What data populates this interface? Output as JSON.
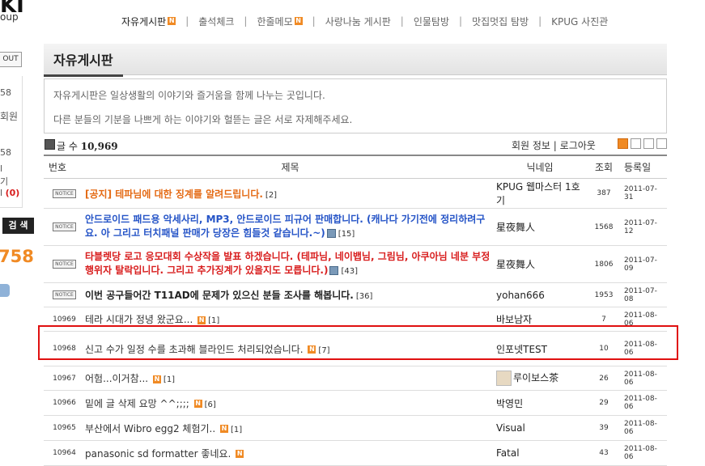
{
  "left": {
    "logo": "KI",
    "logo_sub": "oup",
    "out_label": "OUT",
    "side_lines": [
      "58",
      "회원",
      "58",
      "l",
      "기",
      "l"
    ],
    "side_count_red": "(0)",
    "search_label": "검 색",
    "big_count": "758"
  },
  "topnav": {
    "items": [
      {
        "label": "자유게시판",
        "new": true,
        "current": true
      },
      {
        "label": "출석체크",
        "new": false
      },
      {
        "label": "한줄메모",
        "new": true
      },
      {
        "label": "사랑나눔 게시판",
        "new": false
      },
      {
        "label": "인물탐방",
        "new": false
      },
      {
        "label": "맛집멋집 탐방",
        "new": false
      },
      {
        "label": "KPUG 사진관",
        "new": false
      }
    ],
    "new_badge": "N"
  },
  "board": {
    "title": "자유게시판",
    "desc1": "자유게시판은 일상생활의 이야기와 즐거움을 함께 나누는 곳입니다.",
    "desc2": "다른 분들의 기분을 나쁘게 하는 이야기와 헐뜯는 글은 서로 자제해주세요.",
    "count_label": "글 수",
    "count_value": "10,969",
    "member_info": "회원 정보",
    "logout": "로그아웃",
    "columns": {
      "num": "번호",
      "title": "제목",
      "nick": "닉네임",
      "views": "조회",
      "date": "등록일"
    },
    "notice_label": "NOTICE",
    "notices": [
      {
        "title": "[공지] 테파님에 대한 징계를 알려드립니다.",
        "count": "[2]",
        "style": "orange",
        "nick": "KPUG 웹마스터 1호기",
        "views": "387",
        "date": "2011-07-31"
      },
      {
        "title": "안드로이드 패드용 악세사리, MP3, 안드로이드 피규어 판매합니다. (캐나다 가기전에 정리하려구요. 아 그리고 터치패널 판매가 당장은 힘들것 같습니다.~)",
        "count": "[15]",
        "style": "blue",
        "nick": "星夜舞人",
        "views": "1568",
        "date": "2011-07-12"
      },
      {
        "title": "타블렛당 로고 응모대회 수상작을 발표 하겠습니다. (테파님, 네이뱁님, 그림님, 아쿠아님 네분 부정행위자 탈락입니다. 그리고 추가징계가 있을지도 모릅니다.)",
        "count": "[43]",
        "style": "red",
        "nick": "星夜舞人",
        "views": "1806",
        "date": "2011-07-09"
      },
      {
        "title": "이번 공구들어간 T11AD에 문제가 있으신 분들 조사를 해봅니다.",
        "count": "[36]",
        "style": "black",
        "nick": "yohan666",
        "views": "1953",
        "date": "2011-07-08"
      }
    ],
    "posts": [
      {
        "num": "10969",
        "title": "테라 시대가 정녕 왔군요...",
        "new": true,
        "count": "[1]",
        "nick": "바보남자",
        "views": "7",
        "date": "2011-08-06"
      },
      {
        "num": "10968",
        "title": "신고 수가 일정 수를 초과해 블라인드 처리되었습니다.",
        "new": true,
        "count": "[7]",
        "nick": "인포넷TEST",
        "views": "10",
        "date": "2011-08-06"
      },
      {
        "num": "10967",
        "title": "어험...이거참...",
        "new": true,
        "count": "[1]",
        "nick": "루이보스茶",
        "avatar": true,
        "views": "26",
        "date": "2011-08-06"
      },
      {
        "num": "10966",
        "title": "밑에 글 삭제 요망 ^^;;;;",
        "new": true,
        "count": "[6]",
        "nick": "박영민",
        "views": "29",
        "date": "2011-08-06"
      },
      {
        "num": "10965",
        "title": "부산에서 Wibro egg2 체험기..",
        "new": true,
        "count": "[1]",
        "nick": "Visual",
        "views": "39",
        "date": "2011-08-06"
      },
      {
        "num": "10964",
        "title": "panasonic sd formatter 좋네요.",
        "new": true,
        "count": "",
        "nick": "Fatal",
        "views": "43",
        "date": "2011-08-06"
      }
    ]
  },
  "colors": {
    "accent": "#f08a24",
    "highlight": "#e01010"
  }
}
